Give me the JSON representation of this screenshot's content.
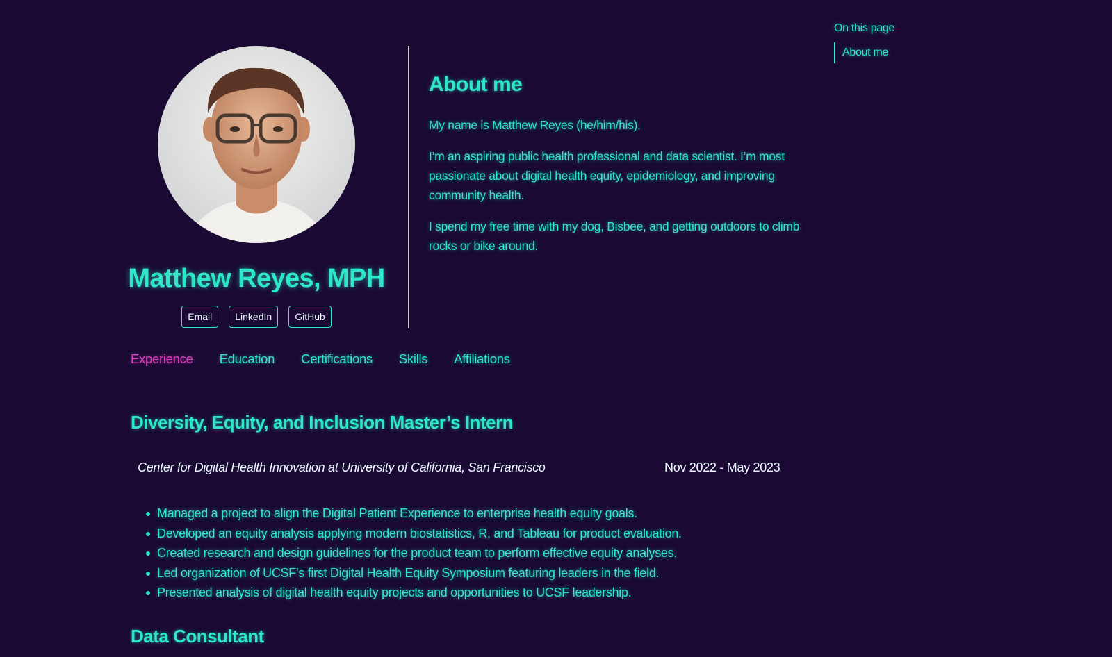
{
  "toc": {
    "title": "On this page",
    "items": [
      {
        "label": "About me"
      }
    ]
  },
  "profile": {
    "name": "Matthew Reyes, MPH",
    "links": [
      {
        "label": "Email"
      },
      {
        "label": "LinkedIn"
      },
      {
        "label": "GitHub"
      }
    ]
  },
  "about": {
    "title": "About me",
    "paragraphs": [
      "My name is Matthew Reyes (he/him/his).",
      "I’m an aspiring public health professional and data scientist. I’m most passionate about digital health equity, epidemiology, and improving community health.",
      "I spend my free time with my dog, Bisbee, and getting outdoors to climb rocks or bike around."
    ]
  },
  "tabs": [
    {
      "label": "Experience",
      "active": true
    },
    {
      "label": "Education"
    },
    {
      "label": "Certifications"
    },
    {
      "label": "Skills"
    },
    {
      "label": "Affiliations"
    }
  ],
  "experience": [
    {
      "title": "Diversity, Equity, and Inclusion Master’s Intern",
      "organization": "Center for Digital Health Innovation at University of California, San Francisco",
      "dates": "Nov 2022 - May 2023",
      "bullets": [
        "Managed a project to align the Digital Patient Experience to enterprise health equity goals.",
        "Developed an equity analysis applying modern biostatistics, R, and Tableau for product evaluation.",
        "Created research and design guidelines for the product team to perform effective equity analyses.",
        "Led organization of UCSF’s first Digital Health Equity Symposium featuring leaders in the field.",
        "Presented analysis of digital health equity projects and opportunities to UCSF leadership."
      ]
    },
    {
      "title": "Data Consultant"
    }
  ],
  "colors": {
    "background": "#1a0a33",
    "accent": "#2ee6c8",
    "active_tab": "#e040c0",
    "meta_text": "#eaf7ff"
  }
}
